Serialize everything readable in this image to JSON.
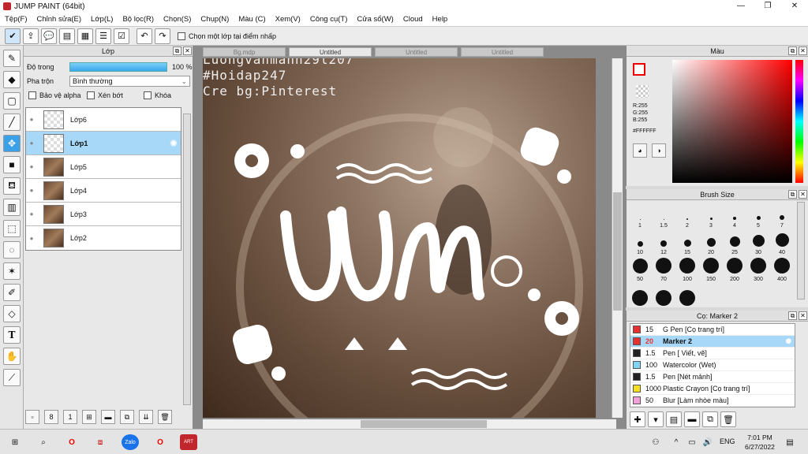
{
  "window": {
    "title": "JUMP PAINT (64bit)"
  },
  "menu": [
    "Tệp(F)",
    "Chỉnh sửa(E)",
    "Lớp(L)",
    "Bộ lọc(R)",
    "Chọn(S)",
    "Chụp(N)",
    "Màu (C)",
    "Xem(V)",
    "Công cụ(T)",
    "Cửa sổ(W)",
    "Cloud",
    "Help"
  ],
  "toolbar": {
    "checkbox_label": "Chọn một lớp tại điểm nhấp"
  },
  "layer_panel": {
    "title": "Lớp",
    "opacity_label": "Độ trong",
    "opacity_value": "100 %",
    "opacity": 1.0,
    "blend_label": "Pha trộn",
    "blend_value": "Bình thường",
    "checks": [
      "Bảo vệ alpha",
      "Xén bớt",
      "Khóa"
    ],
    "layers": [
      {
        "name": "Lớp6",
        "thumb": "transparent",
        "selected": false
      },
      {
        "name": "Lớp1",
        "thumb": "transparent",
        "selected": true
      },
      {
        "name": "Lớp5",
        "thumb": "photo",
        "selected": false
      },
      {
        "name": "Lớp4",
        "thumb": "photo",
        "selected": false
      },
      {
        "name": "Lớp3",
        "thumb": "photo",
        "selected": false
      },
      {
        "name": "Lớp2",
        "thumb": "photo",
        "selected": false
      }
    ]
  },
  "canvas": {
    "tabs": [
      "Bg.mdp",
      "Untitled",
      "Untitled",
      "Untitled"
    ],
    "watermark": [
      "Luongvanmanh29l207",
      "#Hoidap247",
      "Cre bg:Pinterest"
    ]
  },
  "color_panel": {
    "title": "Màu",
    "r": "R:255",
    "g": "G:255",
    "b": "B:255",
    "hex": "#FFFFFF"
  },
  "brush_panel": {
    "title": "Brush Size",
    "sizes": [
      "1",
      "1.5",
      "2",
      "3",
      "4",
      "5",
      "7",
      "10",
      "12",
      "15",
      "20",
      "25",
      "30",
      "40",
      "50",
      "70",
      "100",
      "150",
      "200",
      "300",
      "400",
      "",
      "",
      ""
    ]
  },
  "marker_panel": {
    "title": "Cọ: Marker 2",
    "items": [
      {
        "size": "15",
        "name": "G Pen [Cọ trang trí]",
        "color": "#e83030",
        "selected": false
      },
      {
        "size": "20",
        "name": "Marker 2",
        "color": "#e83030",
        "selected": true
      },
      {
        "size": "1.5",
        "name": "Pen [ Viết, vẽ]",
        "color": "#222222",
        "selected": false
      },
      {
        "size": "100",
        "name": "Watercolor (Wet)",
        "color": "#7fd4f4",
        "selected": false
      },
      {
        "size": "1.5",
        "name": "Pen [Nét mảnh]",
        "color": "#222222",
        "selected": false
      },
      {
        "size": "1000",
        "name": "Plastic Crayon [Cọ trang trí]",
        "color": "#f4e020",
        "selected": false
      },
      {
        "size": "50",
        "name": "Blur [Làm nhòe màu]",
        "color": "#f4a0d8",
        "selected": false
      }
    ]
  },
  "taskbar": {
    "lang": "ENG",
    "time": "7:01 PM",
    "date": "6/27/2022"
  }
}
